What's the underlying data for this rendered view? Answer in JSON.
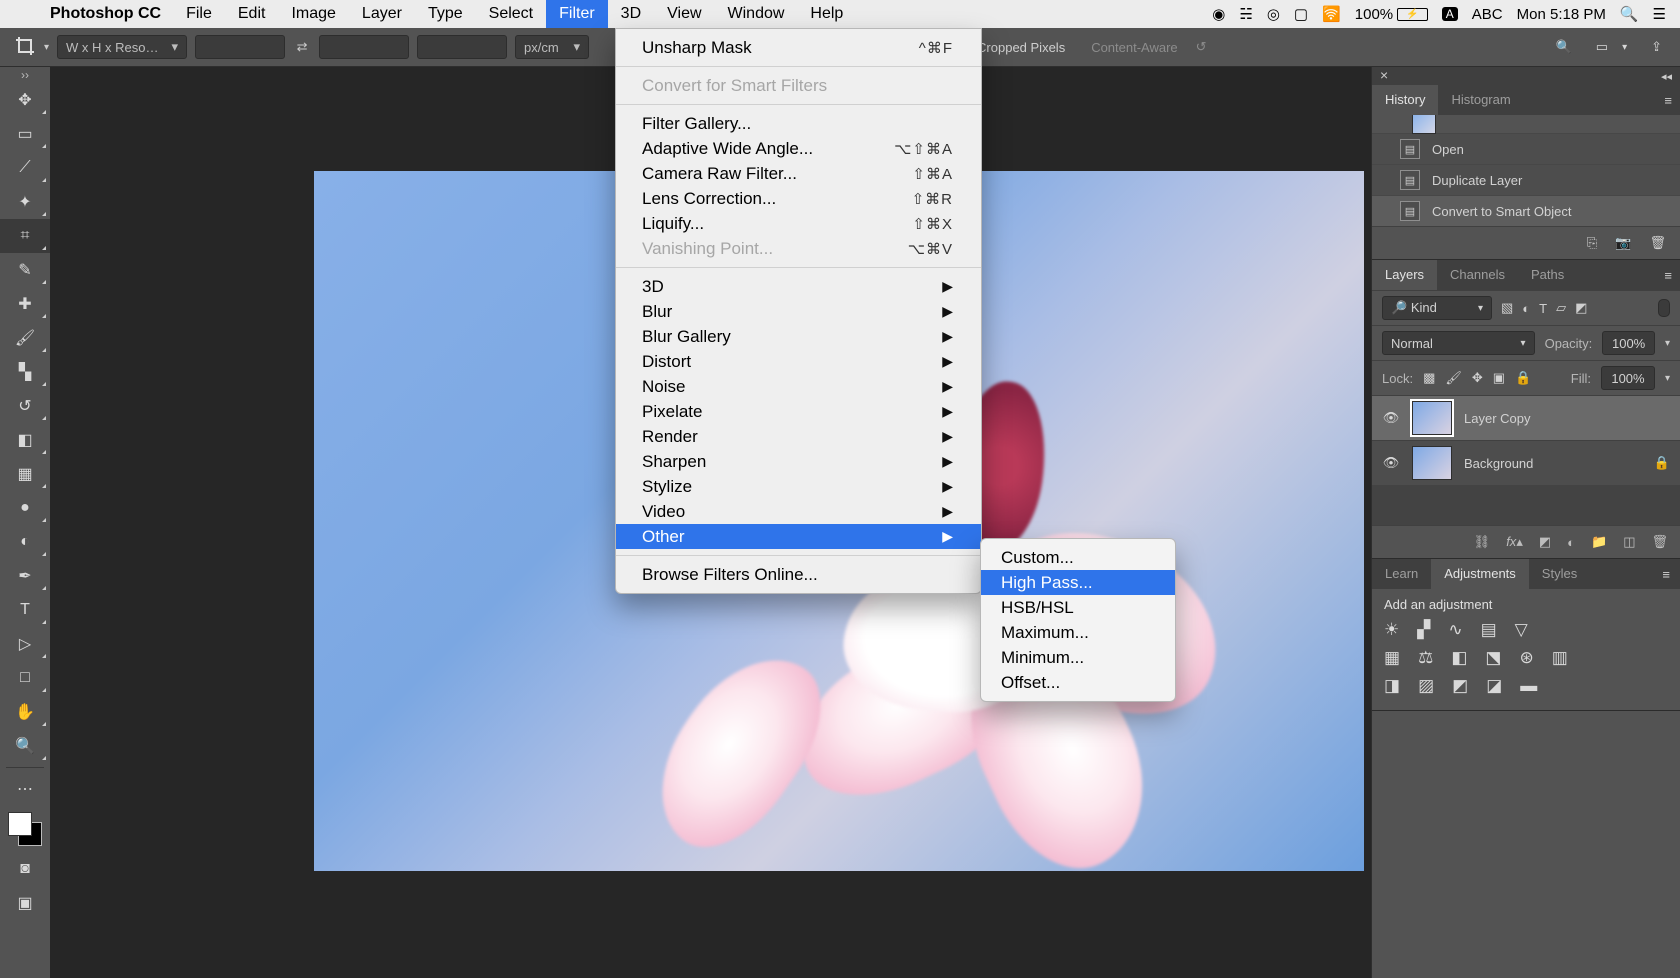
{
  "menubar": {
    "apple": "",
    "app": "Photoshop CC",
    "items": [
      "File",
      "Edit",
      "Image",
      "Layer",
      "Type",
      "Select",
      "Filter",
      "3D",
      "View",
      "Window",
      "Help"
    ],
    "active_index": 6,
    "status": {
      "battery": "100%",
      "input": "ABC",
      "clock": "Mon 5:18 PM"
    }
  },
  "optbar": {
    "preset": "W x H x Reso…",
    "unit": "px/cm",
    "cropped": "Cropped Pixels",
    "content_aware": "Content-Aware"
  },
  "tools": [
    "move-tool",
    "marquee-tool",
    "lasso-tool",
    "magic-wand-tool",
    "crop-tool",
    "eyedropper-tool",
    "healing-brush-tool",
    "brush-tool",
    "clone-stamp-tool",
    "history-brush-tool",
    "eraser-tool",
    "gradient-tool",
    "blur-tool",
    "dodge-tool",
    "pen-tool",
    "type-tool",
    "path-selection-tool",
    "rectangle-tool",
    "hand-tool",
    "zoom-tool"
  ],
  "tools_active_index": 4,
  "tool_glyphs": [
    "✥",
    "▭",
    "⟋",
    "✦",
    "⌗",
    "✎",
    "✚",
    "🖌",
    "▚",
    "↺",
    "◧",
    "▦",
    "●",
    "◐",
    "✒",
    "T",
    "▷",
    "□",
    "✋",
    "🔍"
  ],
  "filter_menu": [
    {
      "label": "Unsharp Mask",
      "shortcut": "^⌘F"
    },
    {
      "sep": true
    },
    {
      "label": "Convert for Smart Filters",
      "disabled": true
    },
    {
      "sep": true
    },
    {
      "label": "Filter Gallery..."
    },
    {
      "label": "Adaptive Wide Angle...",
      "shortcut": "⌥⇧⌘A"
    },
    {
      "label": "Camera Raw Filter...",
      "shortcut": "⇧⌘A"
    },
    {
      "label": "Lens Correction...",
      "shortcut": "⇧⌘R"
    },
    {
      "label": "Liquify...",
      "shortcut": "⇧⌘X"
    },
    {
      "label": "Vanishing Point...",
      "shortcut": "⌥⌘V",
      "disabled": true
    },
    {
      "sep": true
    },
    {
      "label": "3D",
      "sub": true
    },
    {
      "label": "Blur",
      "sub": true
    },
    {
      "label": "Blur Gallery",
      "sub": true
    },
    {
      "label": "Distort",
      "sub": true
    },
    {
      "label": "Noise",
      "sub": true
    },
    {
      "label": "Pixelate",
      "sub": true
    },
    {
      "label": "Render",
      "sub": true
    },
    {
      "label": "Sharpen",
      "sub": true
    },
    {
      "label": "Stylize",
      "sub": true
    },
    {
      "label": "Video",
      "sub": true
    },
    {
      "label": "Other",
      "sub": true,
      "hl": true
    },
    {
      "sep": true
    },
    {
      "label": "Browse Filters Online..."
    }
  ],
  "other_menu": [
    {
      "label": "Custom..."
    },
    {
      "label": "High Pass...",
      "hl": true
    },
    {
      "label": "HSB/HSL"
    },
    {
      "label": "Maximum..."
    },
    {
      "label": "Minimum..."
    },
    {
      "label": "Offset..."
    }
  ],
  "panels": {
    "history": {
      "tabs": [
        "History",
        "Histogram"
      ],
      "active": 0,
      "rows": [
        "Open",
        "Duplicate Layer",
        "Convert to Smart Object"
      ]
    },
    "layers": {
      "tabs": [
        "Layers",
        "Channels",
        "Paths"
      ],
      "active": 0,
      "kind": "Kind",
      "mode": "Normal",
      "opacity_label": "Opacity:",
      "opacity": "100%",
      "lock_label": "Lock:",
      "fill_label": "Fill:",
      "fill": "100%",
      "rows": [
        {
          "name": "Layer Copy",
          "sel": true,
          "locked": false
        },
        {
          "name": "Background",
          "sel": false,
          "locked": true
        }
      ]
    },
    "bottom": {
      "tabs": [
        "Learn",
        "Adjustments",
        "Styles"
      ],
      "active": 1,
      "heading": "Add an adjustment"
    }
  }
}
